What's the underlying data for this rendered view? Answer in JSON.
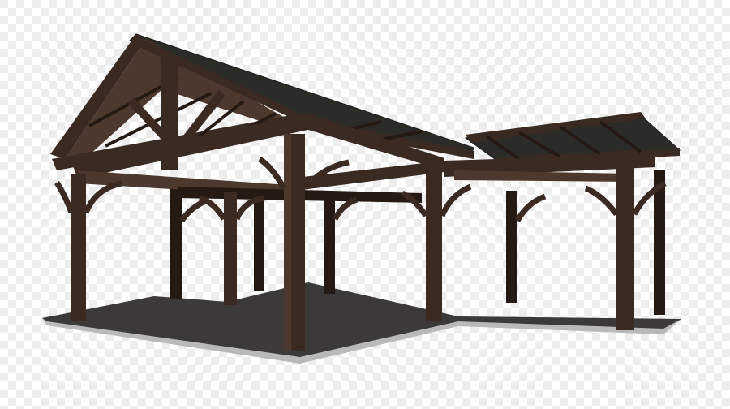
{
  "image": {
    "subject": "pavilion-illustration",
    "colors": {
      "checker_light": "#ffffff",
      "checker_dark": "#ededed",
      "slab_top": "#3b3a38",
      "slab_edge": "#b9b9b9",
      "timber": "#3b2a22",
      "timber_light": "#4d382d",
      "timber_dark": "#251914",
      "roof": "#2b2b28",
      "roof_edge": "#1c1c1a"
    }
  }
}
